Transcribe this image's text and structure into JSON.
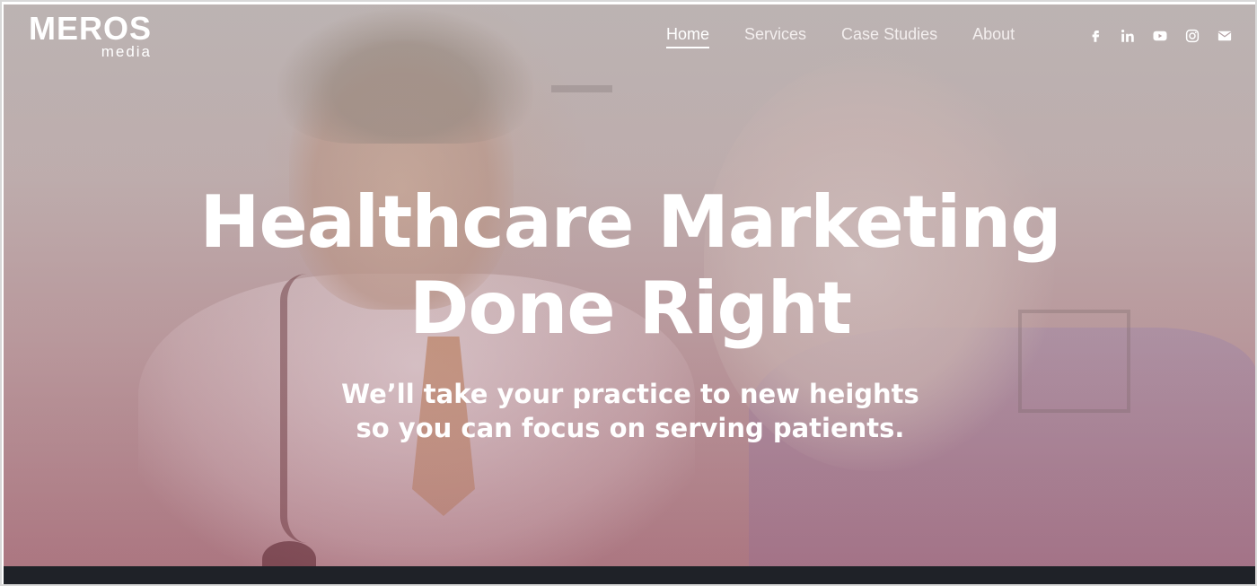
{
  "logo": {
    "main": "MEROS",
    "sub": "media"
  },
  "nav": {
    "items": [
      {
        "label": "Home",
        "active": true
      },
      {
        "label": "Services",
        "active": false
      },
      {
        "label": "Case Studies",
        "active": false
      },
      {
        "label": "About",
        "active": false
      }
    ]
  },
  "social": {
    "icons": [
      "facebook-icon",
      "linkedin-icon",
      "youtube-icon",
      "instagram-icon",
      "email-icon"
    ]
  },
  "hero": {
    "title_line1": "Healthcare Marketing",
    "title_line2": "Done Right",
    "subtitle_line1": "We’ll take your practice to new heights",
    "subtitle_line2": "so you can focus on serving patients."
  },
  "colors": {
    "text": "#ffffff",
    "overlay_top": "#b9b3b1",
    "overlay_bottom": "#a9767f",
    "bottom_bar": "#1f2228"
  }
}
